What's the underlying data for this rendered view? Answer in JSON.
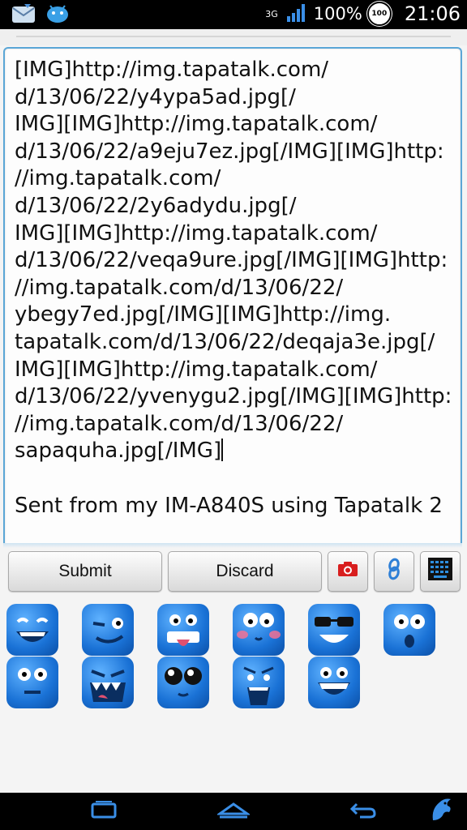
{
  "status_bar": {
    "network": "3G",
    "battery": "100%",
    "badge": "100",
    "time": "21:06",
    "icons": [
      "email-icon",
      "android-icon",
      "signal-icon",
      "battery-badge-icon"
    ]
  },
  "editor": {
    "body": "[IMG]http://img.tapatalk.com/\nd/13/06/22/y4ypa5ad.jpg[/\nIMG][IMG]http://img.tapatalk.com/\nd/13/06/22/a9eju7ez.jpg[/IMG][IMG]http:\n//img.tapatalk.com/\nd/13/06/22/2y6adydu.jpg[/\nIMG][IMG]http://img.tapatalk.com/\nd/13/06/22/veqa9ure.jpg[/IMG][IMG]http:\n//img.tapatalk.com/d/13/06/22/\nybegy7ed.jpg[/IMG][IMG]http://img.\ntapatalk.com/d/13/06/22/deqaja3e.jpg[/\nIMG][IMG]http://img.tapatalk.com/\nd/13/06/22/yvenygu2.jpg[/IMG][IMG]http:\n//img.tapatalk.com/d/13/06/22/\nsapaquha.jpg[/IMG]",
    "signature": "Sent from my IM-A840S using Tapatalk 2"
  },
  "buttons": {
    "submit": "Submit",
    "discard": "Discard"
  },
  "emoticons": [
    "laughing",
    "winking",
    "tongue-out",
    "blushing",
    "sunglasses",
    "surprised",
    "staring",
    "angry-teeth",
    "wide-eyes",
    "shocked",
    "grinning"
  ],
  "colors": {
    "accent": "#5aa6d6",
    "emoticon_blue": "#1a72d6",
    "camera_red": "#d81e1e"
  }
}
